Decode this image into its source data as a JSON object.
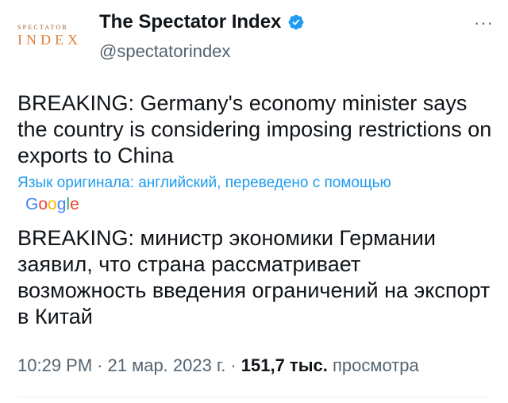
{
  "author": {
    "avatar_top": "SPECTATOR",
    "avatar_bottom": "INDEX",
    "name": "The Spectator Index",
    "handle": "@spectatorindex",
    "verified": true,
    "verified_color": "#1d9bf0"
  },
  "more_label": "···",
  "tweet": {
    "text": "BREAKING: Germany's economy minister says the country is considering imposing restrictions on exports to China",
    "translation_note": "Язык оригинала: английский, переведено с помощью",
    "translator": {
      "letters": [
        "G",
        "o",
        "o",
        "g",
        "l",
        "e"
      ]
    },
    "translated_text": "BREAKING: министр экономики Германии заявил, что страна рассматривает возможность введения ограничений на экспорт в Китай"
  },
  "meta": {
    "time": "10:29 PM",
    "separator": "·",
    "date": "21 мар. 2023 г.",
    "views_count": "151,7 тыс.",
    "views_label": "просмотра"
  }
}
